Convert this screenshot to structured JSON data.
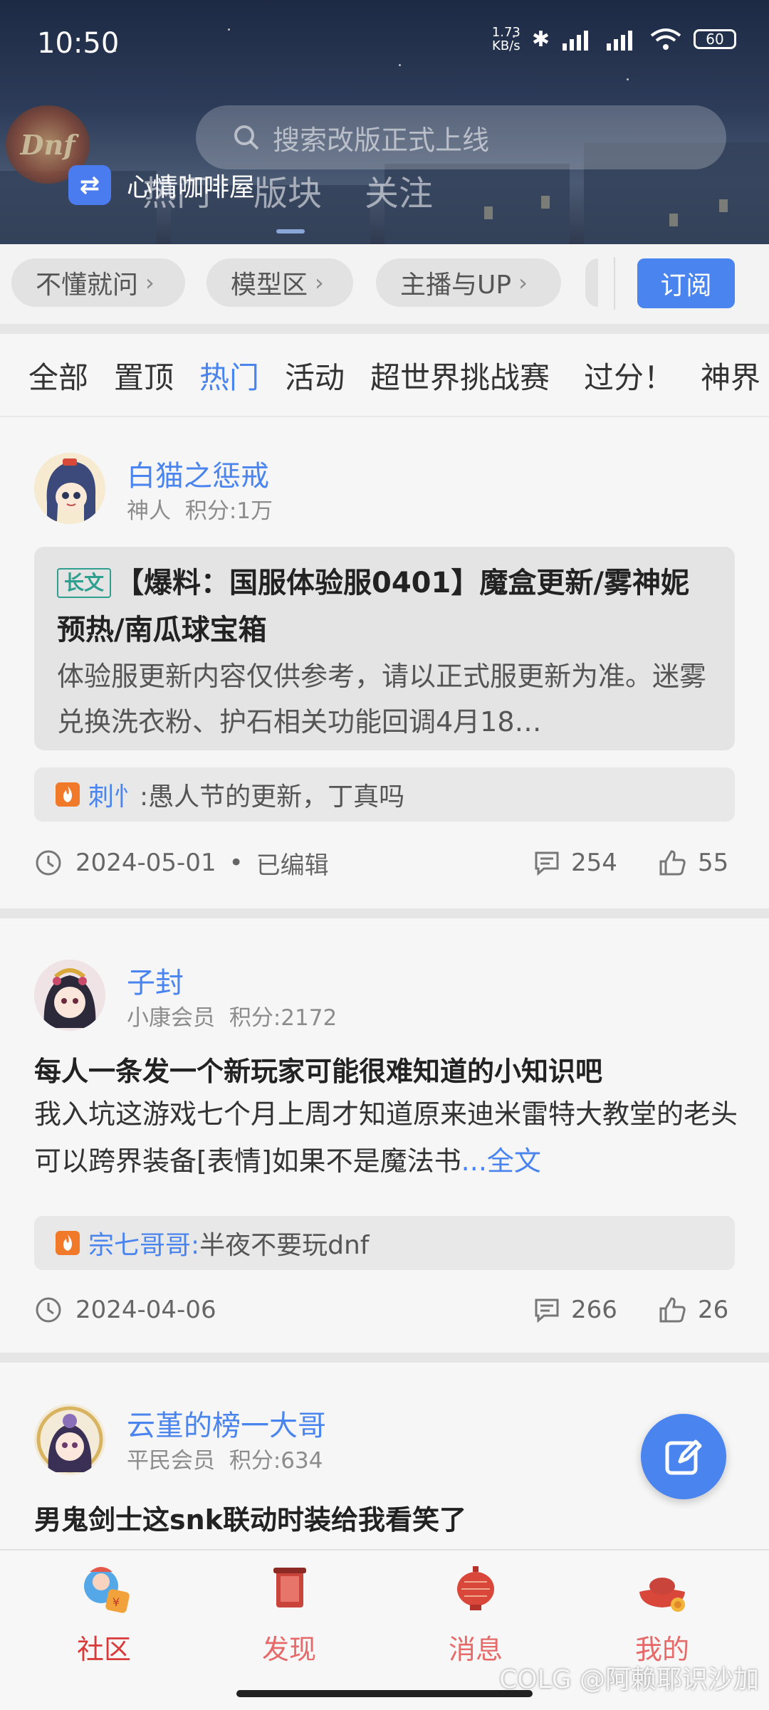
{
  "status_bar": {
    "time": "10:50",
    "net_speed_value": "1.73",
    "net_speed_unit": "KB/s",
    "battery": "60"
  },
  "header": {
    "logo_text": "Dnf",
    "search_placeholder": "搜索改版正式上线",
    "switch_label": "心情咖啡屋",
    "tabs": [
      "热门",
      "版块",
      "关注"
    ]
  },
  "categories": {
    "chips": [
      "不懂就问",
      "模型区",
      "主播与UP"
    ],
    "subscribe_label": "订阅"
  },
  "filters": [
    "全部",
    "置顶",
    "热门",
    "活动",
    "超世界挑战赛",
    "过分！",
    "神界"
  ],
  "active_filter": "热门",
  "posts": [
    {
      "author": "白猫之惩戒",
      "rank": "神人",
      "score": "积分:1万",
      "tag": "长文",
      "title": "【爆料：国服体验服0401】魔盒更新/雾神妮预热/南瓜球宝箱",
      "excerpt": "体验服更新内容仅供参考，请以正式服更新为准。迷雾兑换洗衣粉、护石相关功能回调4月18…",
      "hot_comment_user": "刺忄",
      "hot_comment_text": ":愚人节的更新，丁真吗",
      "date": "2024-05-01",
      "edited": "已编辑",
      "comments": "254",
      "likes": "55"
    },
    {
      "author": "子封",
      "rank": "小康会员",
      "score": "积分:2172",
      "title": "每人一条发一个新玩家可能很难知道的小知识吧",
      "body": "我入坑这游戏七个月上周才知道原来迪米雷特大教堂的老头可以跨界装备[表情]如果不是魔法书",
      "more": "...全文",
      "hot_comment_user": "宗七哥哥:",
      "hot_comment_text": "半夜不要玩dnf",
      "date": "2024-04-06",
      "comments": "266",
      "likes": "26"
    },
    {
      "author": "云堇的榜一大哥",
      "rank": "平民会员",
      "score": "积分:634",
      "title": "男鬼剑士这snk联动时装给我看笑了"
    }
  ],
  "bottom_nav": [
    {
      "label": "社区",
      "icon": "community-icon"
    },
    {
      "label": "发现",
      "icon": "discover-icon"
    },
    {
      "label": "消息",
      "icon": "message-icon"
    },
    {
      "label": "我的",
      "icon": "profile-icon"
    }
  ],
  "watermark": "COLG @阿赖耶识沙加",
  "colors": {
    "accent": "#4a84ee",
    "nav_active": "#d93a3a",
    "tag": "#2f9f8f"
  }
}
